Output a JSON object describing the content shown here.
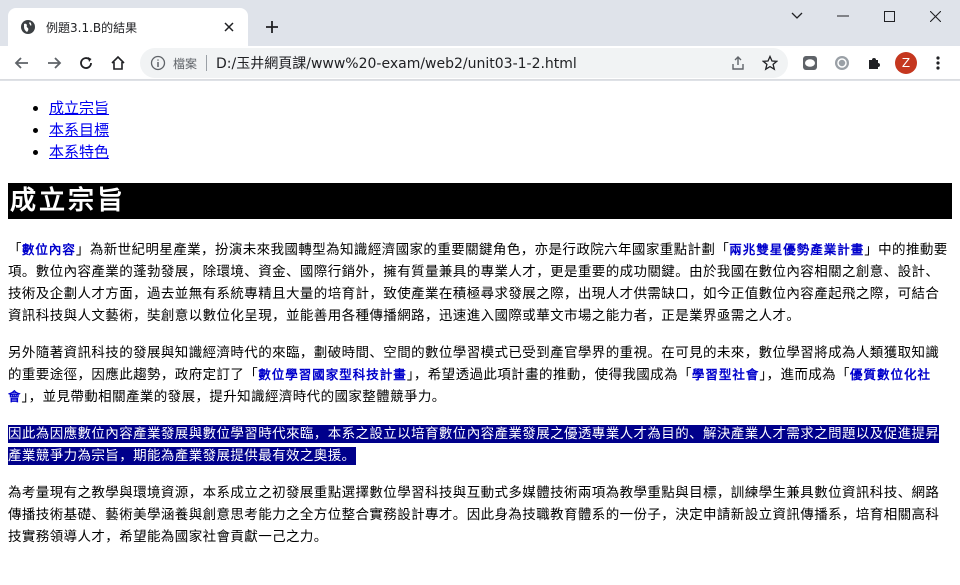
{
  "browser": {
    "tab_title": "例題3.1.B的結果",
    "site_info_label": "檔案",
    "url": "D:/玉井網頁課/www%20-exam/web2/unit03-1-2.html",
    "profile_initial": "Z",
    "accent_color": "#dfe3ea"
  },
  "page": {
    "nav_links": [
      "成立宗旨",
      "本系目標",
      "本系特色"
    ],
    "heading": "成立宗旨",
    "para1": {
      "q1": "「",
      "t1": "數位內容",
      "s1": "」為新世紀明星產業，扮演未來我國轉型為知識經濟國家的重要關鍵角色，亦是行政院六年國家重點計劃「",
      "t2": "兩兆雙星優勢產業計畫",
      "s2": "」中的推動要項。數位內容產業的蓬勃發展，除環境、資金、國際行銷外，擁有質量兼具的專業人才，更是重要的成功關鍵。由於我國在數位內容相關之創意、設計、技術及企劃人才方面，過去並無有系統專精且大量的培育計，致使產業在積極尋求發展之際，出現人才供需缺口，如今正值數位內容產起飛之際，可結合資訊科技與人文藝術，奘創意以數位化呈現，並能善用各種傳播網路，迅速進入國際或華文市場之能力者，正是業界亟需之人才。"
    },
    "para2": {
      "s0": "另外隨著資訊科技的發展與知識經濟時代的來臨，劃破時間、空間的數位學習模式已受到產官學界的重視。在可見的未來，數位學習將成為人類獲取知識的重要途徑，因應此趨勢，政府定訂了「",
      "t1": "數位學習國家型科技計畫",
      "s1": "」，希望透過此項計畫的推動，使得我國成為「",
      "t2": "學習型社會",
      "s2": "」，進而成為「",
      "t3": "優質數位化社會",
      "s3": "」，並見帶動相關產業的發展，提升知識經濟時代的國家整體競爭力。"
    },
    "para3": "因此為因應數位內容產業發展與數位學習時代來臨，本系之設立以培育數位內容產業發展之優透專業人才為目的、解決產業人才需求之問題以及促進提昇產業競爭力為宗旨，期能為產業發展提供最有效之奧援。",
    "para4": "為考量現有之教學與環境資源，本系成立之初發展重點選擇數位學習科技與互動式多媒體技術兩項為教學重點與目標，訓練學生兼具數位資訊科技、網路傳播技術基礎、藝術美學涵養與創意思考能力之全方位整合實務設計專才。因此身為技職教育體系的一份子，決定申請新設立資訊傳播系，培育相關高科技實務領導人才，希望能為國家社會貢獻一己之力。"
  }
}
